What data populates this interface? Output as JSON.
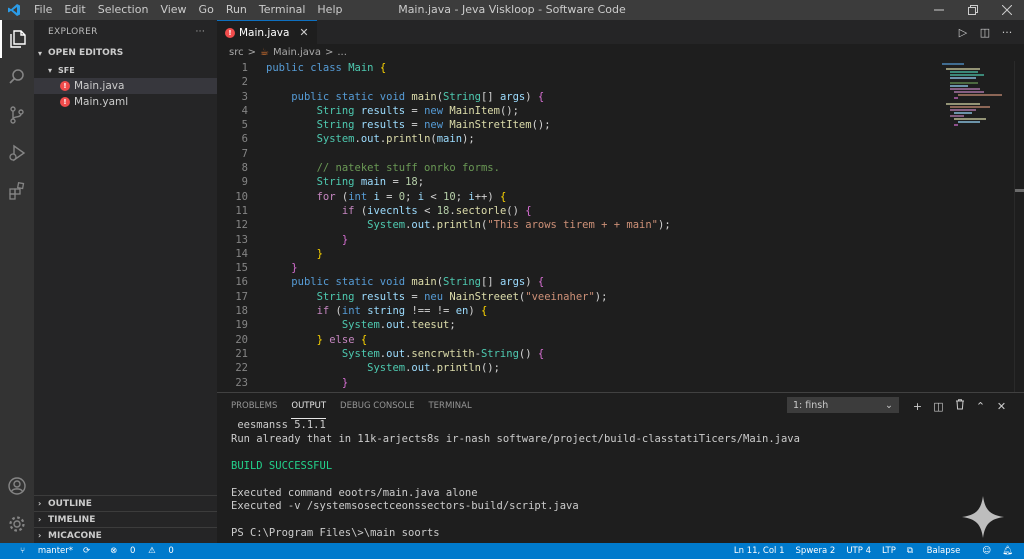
{
  "app": {
    "title": "Main.java - Jeva Viskloop - Software Code",
    "menu": [
      "File",
      "Edit",
      "Selection",
      "View",
      "Go",
      "Run",
      "Terminal",
      "Help"
    ],
    "accent": "#007acc"
  },
  "sidebar": {
    "header": "EXPLORER",
    "more": "···",
    "open_editors": "OPEN EDITORS",
    "folder": "SFE",
    "files": [
      {
        "name": "Main.java",
        "badge": "!"
      },
      {
        "name": "Main.yaml",
        "badge": "!"
      }
    ],
    "outline": "OUTLINE",
    "timeline": "TIMELINE",
    "micacone": "MICACONE"
  },
  "editor": {
    "tab": {
      "label": "Main.java",
      "badge": "!"
    },
    "breadcrumb": [
      "src",
      ">",
      "Main.java",
      ">",
      "..."
    ],
    "lines": [
      "1",
      "2",
      "3",
      "4",
      "5",
      "6",
      "7",
      "8",
      "9",
      "10",
      "11",
      "12",
      "13",
      "14",
      "15",
      "16",
      "17",
      "18",
      "19",
      "20",
      "21",
      "22",
      "23"
    ]
  },
  "panel": {
    "tabs": [
      "PROBLEMS",
      "OUTPUT",
      "DEBUG CONSOLE",
      "TERMINAL"
    ],
    "active_tab": "OUTPUT",
    "dropdown": "1: finsh",
    "output": [
      " eesmanss 5.1.1",
      "Run already that in 11k-arjects8s ir-nash software/project/build-classtatiTicers/Main.java",
      "",
      "BUILD SUCCESSFUL",
      "",
      "Executed command eootrs/main.java alone",
      "Executed -v /systemsosectceonssectors-build/script.java",
      "",
      "PS C:\\Program Files\\>\\main soorts"
    ]
  },
  "statusbar": {
    "branch": "manter*",
    "errors": "0",
    "warnings": "0",
    "position": "Ln 11, Col 1",
    "spaces": "Spwera 2",
    "encoding": "UTP 4",
    "eol": "LTP",
    "language": "Balapse"
  }
}
